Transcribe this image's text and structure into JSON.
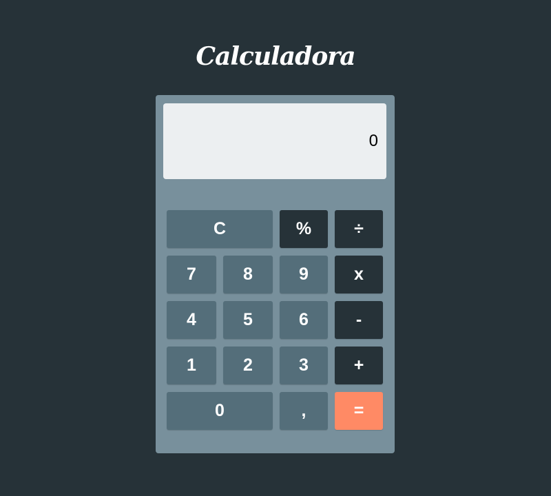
{
  "app": {
    "title": "Calculadora"
  },
  "display": {
    "value": "0"
  },
  "keys": {
    "clear": "C",
    "percent": "%",
    "divide": "÷",
    "seven": "7",
    "eight": "8",
    "nine": "9",
    "multiply": "x",
    "four": "4",
    "five": "5",
    "six": "6",
    "subtract": "-",
    "one": "1",
    "two": "2",
    "three": "3",
    "add": "+",
    "zero": "0",
    "decimal": ",",
    "equals": "="
  },
  "colors": {
    "background": "#263238",
    "calculator_body": "#78909c",
    "display_background": "#eceff1",
    "number_key": "#546e7a",
    "operator_key": "#263238",
    "equals_key": "#ff8a65"
  }
}
